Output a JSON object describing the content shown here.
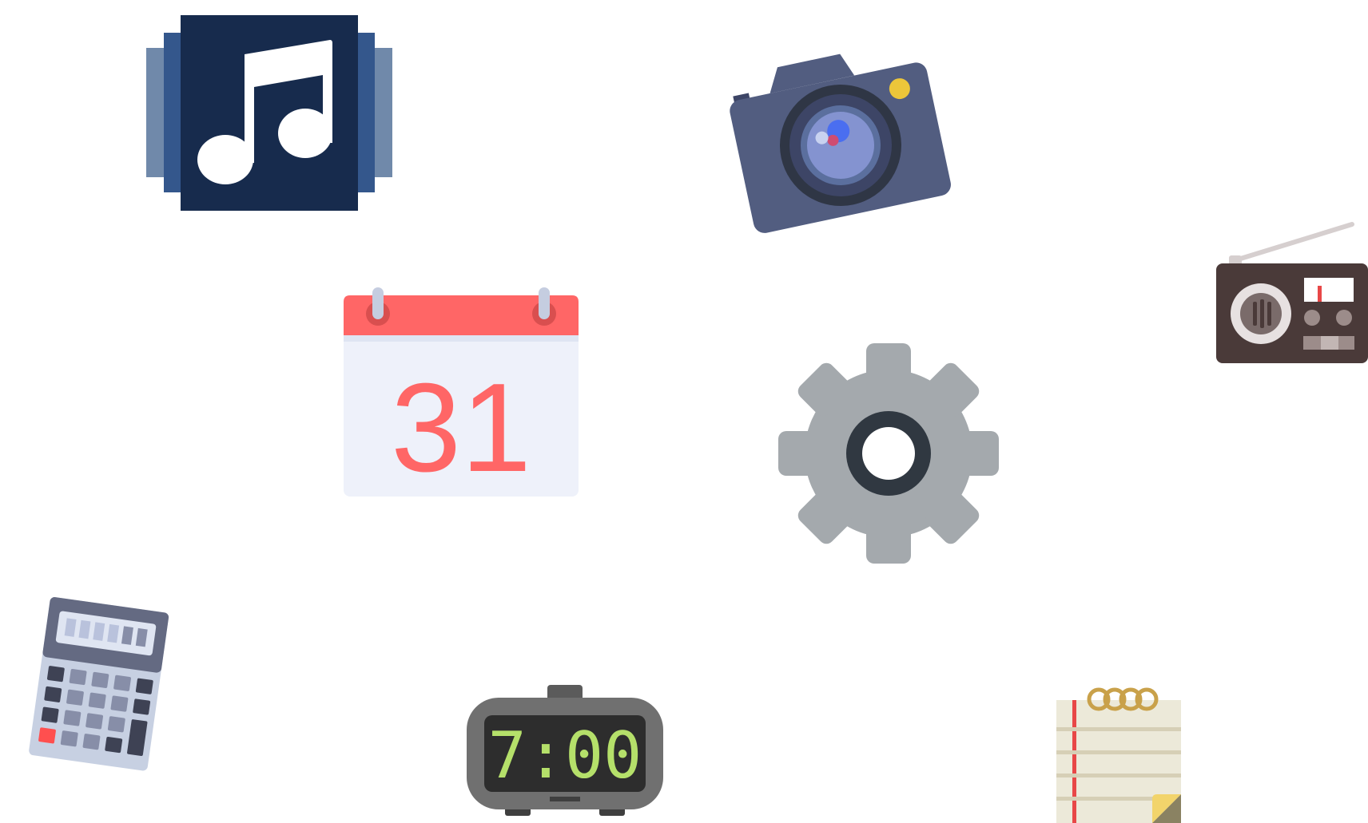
{
  "desktop": {
    "icons": [
      {
        "id": "music",
        "icon": "music-icon"
      },
      {
        "id": "camera",
        "icon": "camera-icon"
      },
      {
        "id": "radio",
        "icon": "radio-icon"
      },
      {
        "id": "calendar",
        "icon": "calendar-icon",
        "date_text": "31"
      },
      {
        "id": "settings",
        "icon": "gear-icon"
      },
      {
        "id": "calculator",
        "icon": "calculator-icon"
      },
      {
        "id": "clock",
        "icon": "alarm-clock-icon",
        "time_text": "7:00"
      },
      {
        "id": "notepad",
        "icon": "notepad-icon"
      }
    ]
  },
  "colors": {
    "music_bg": "#172b4d",
    "camera_body": "#525d80",
    "calendar_red": "#ff6666",
    "gear_gray": "#a4a9ad",
    "radio_body": "#4a3a39",
    "clock_digits": "#b5e06a"
  }
}
